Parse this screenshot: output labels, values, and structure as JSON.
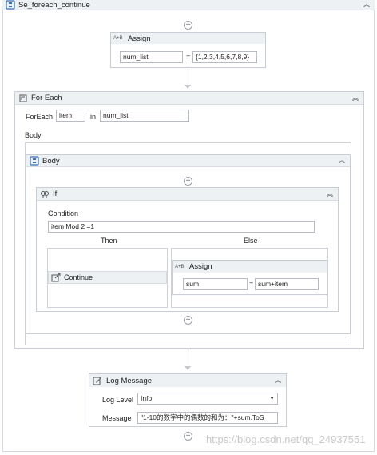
{
  "sequence": {
    "title": "Se_foreach_continue"
  },
  "assign1": {
    "title": "Assign",
    "icon": "assign-icon",
    "to": "num_list",
    "equals": "=",
    "value": "{1,2,3,4,5,6,7,8,9}"
  },
  "foreach": {
    "title": "For Each",
    "icon": "foreach-icon",
    "foreach_label": "ForEach",
    "item": "item",
    "in_label": "in",
    "collection": "num_list",
    "body_label": "Body"
  },
  "body_seq": {
    "title": "Body",
    "icon": "sequence-icon"
  },
  "if_act": {
    "title": "If",
    "icon": "if-icon",
    "condition_label": "Condition",
    "condition": "item Mod 2 =1",
    "then_label": "Then",
    "else_label": "Else"
  },
  "continue_act": {
    "title": "Continue",
    "icon": "continue-icon"
  },
  "assign2": {
    "title": "Assign",
    "icon": "assign-icon",
    "to": "sum",
    "equals": "=",
    "value": "sum+item"
  },
  "log": {
    "title": "Log Message",
    "icon": "log-icon",
    "level_label": "Log Level",
    "level_value": "Info",
    "message_label": "Message",
    "message_value": "\"1-10的数字中的偶数的和为：\"+sum.ToS"
  },
  "watermark": "https://blog.csdn.net/qq_24937551",
  "colors": {
    "header_bg": "#eef1f4",
    "border": "#c9ced6",
    "icon_blue": "#3b6fb6"
  }
}
